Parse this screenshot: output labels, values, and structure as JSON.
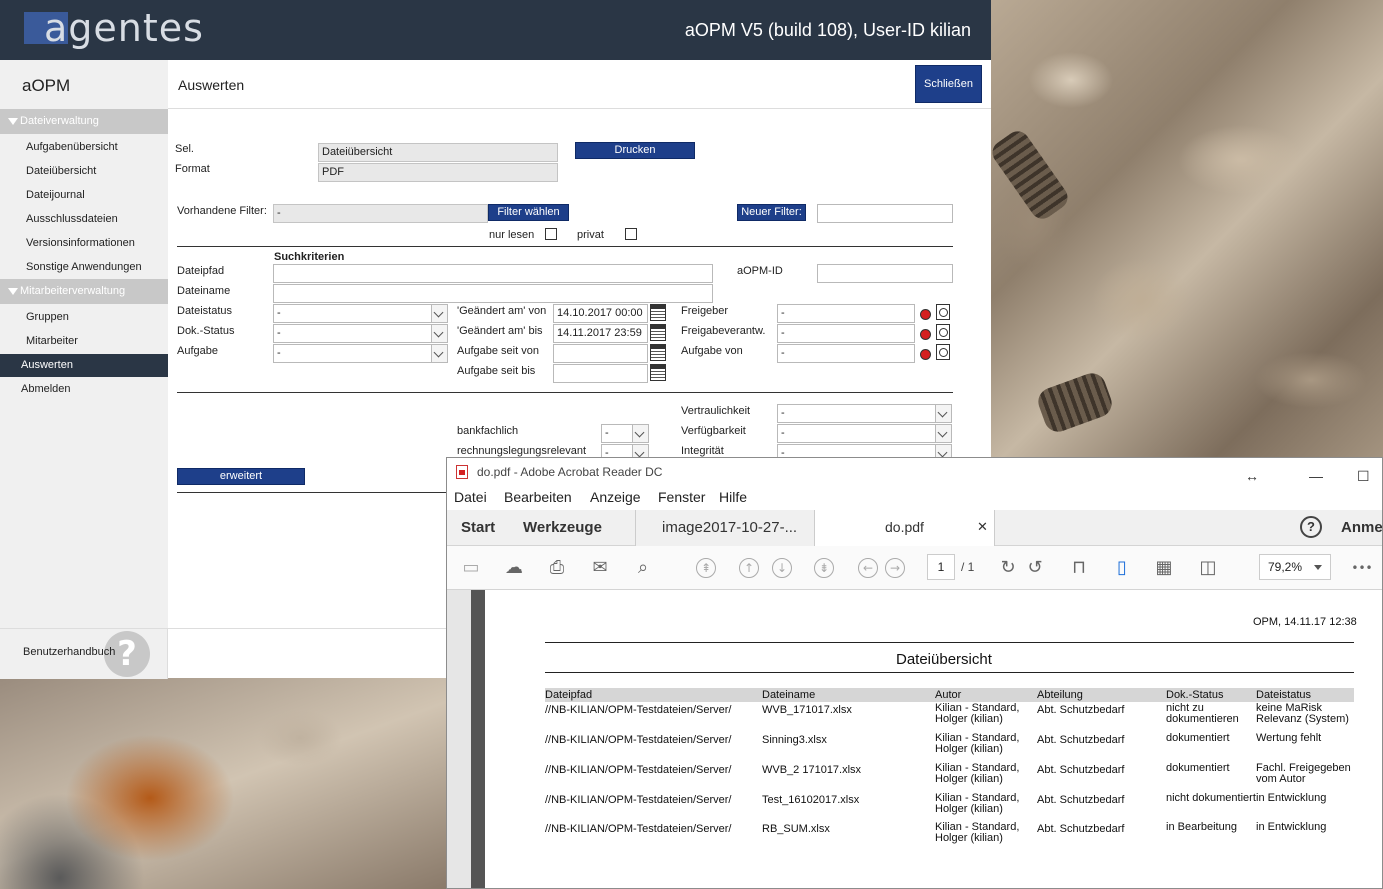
{
  "header": {
    "logo": "agentes",
    "title": "aOPM V5 (build 108), User-ID kilian"
  },
  "sidebar": {
    "app_name": "aOPM",
    "sections": [
      {
        "label": "Dateiverwaltung",
        "items": [
          "Aufgabenübersicht",
          "Dateiübersicht",
          "Dateijournal",
          "Ausschlussdateien",
          "Versionsinformationen",
          "Sonstige Anwendungen"
        ]
      },
      {
        "label": "Mitarbeiterverwaltung",
        "items": [
          "Gruppen",
          "Mitarbeiter"
        ]
      }
    ],
    "active": "Auswerten",
    "logout": "Abmelden",
    "help": "Benutzerhandbuch",
    "help_icon": "question-icon"
  },
  "main": {
    "title": "Auswerten",
    "close": "Schließen",
    "sel_label": "Sel.",
    "sel_value": "Dateiübersicht",
    "format_label": "Format",
    "format_value": "PDF",
    "print": "Drucken",
    "filter_label": "Vorhandene Filter:",
    "filter_value": "-",
    "filter_choose": "Filter wählen",
    "new_filter": "Neuer Filter:",
    "readonly_label": "nur lesen",
    "private_label": "privat",
    "criteria_title": "Suchkriterien",
    "filepath": "Dateipfad",
    "filename": "Dateiname",
    "aopm_id": "aOPM-ID",
    "filestatus": "Dateistatus",
    "dokstatus": "Dok.-Status",
    "task": "Aufgabe",
    "dash": "-",
    "changed_from": "'Geändert am' von",
    "changed_from_val": "14.10.2017 00:00",
    "changed_to": "'Geändert am' bis",
    "changed_to_val": "14.11.2017 23:59",
    "task_since_from": "Aufgabe seit von",
    "task_since_to": "Aufgabe seit bis",
    "approver": "Freigeber",
    "approver_resp": "Freigabeverantw.",
    "task_from": "Aufgabe von",
    "confidentiality": "Vertraulichkeit",
    "availability": "Verfügbarkeit",
    "integrity": "Integrität",
    "banking": "bankfachlich",
    "accounting": "rechnungslegungsrelevant",
    "extended": "erweitert"
  },
  "acrobat": {
    "title": "do.pdf - Adobe Acrobat Reader DC",
    "menu": [
      "Datei",
      "Bearbeiten",
      "Anzeige",
      "Fenster",
      "Hilfe"
    ],
    "tab_start": "Start",
    "tab_tools": "Werkzeuge",
    "tab_image": "image2017-10-27-...",
    "tab_doc": "do.pdf",
    "help_q": "?",
    "login": "Anme",
    "page": "1",
    "page_total": "/ 1",
    "zoom": "79,2%",
    "more": "•••"
  },
  "pdf": {
    "timestamp": "OPM, 14.11.17 12:38",
    "heading": "Dateiübersicht",
    "columns": [
      "Dateipfad",
      "Dateiname",
      "Autor",
      "Abteilung",
      "Dok.-Status",
      "Dateistatus"
    ],
    "rows": [
      {
        "path": "//NB-KILIAN/OPM-Testdateien/Server/",
        "name": "WVB_171017.xlsx",
        "author1": "Kilian - Standard,",
        "author2": "Holger (kilian)",
        "dept": "Abt. Schutzbedarf",
        "dok1": "nicht zu",
        "dok2": "dokumentieren",
        "st1": "keine MaRisk",
        "st2": "Relevanz (System)"
      },
      {
        "path": "//NB-KILIAN/OPM-Testdateien/Server/",
        "name": "Sinning3.xlsx",
        "author1": "Kilian - Standard,",
        "author2": "Holger (kilian)",
        "dept": "Abt. Schutzbedarf",
        "dok1": "dokumentiert",
        "dok2": "",
        "st1": "Wertung fehlt",
        "st2": ""
      },
      {
        "path": "//NB-KILIAN/OPM-Testdateien/Server/",
        "name": "WVB_2 171017.xlsx",
        "author1": "Kilian - Standard,",
        "author2": "Holger (kilian)",
        "dept": "Abt. Schutzbedarf",
        "dok1": "dokumentiert",
        "dok2": "",
        "st1": "Fachl. Freigegeben",
        "st2": "vom Autor"
      },
      {
        "path": "//NB-KILIAN/OPM-Testdateien/Server/",
        "name": "Test_16102017.xlsx",
        "author1": "Kilian - Standard,",
        "author2": "Holger (kilian)",
        "dept": "Abt. Schutzbedarf",
        "dok1": "nicht dokumentiert",
        "dok2": "",
        "st1": "in Entwicklung",
        "st2": ""
      },
      {
        "path": "//NB-KILIAN/OPM-Testdateien/Server/",
        "name": "RB_SUM.xlsx",
        "author1": "Kilian - Standard,",
        "author2": "Holger (kilian)",
        "dept": "Abt. Schutzbedarf",
        "dok1": "in Bearbeitung",
        "dok2": "",
        "st1": "in Entwicklung",
        "st2": ""
      }
    ]
  }
}
